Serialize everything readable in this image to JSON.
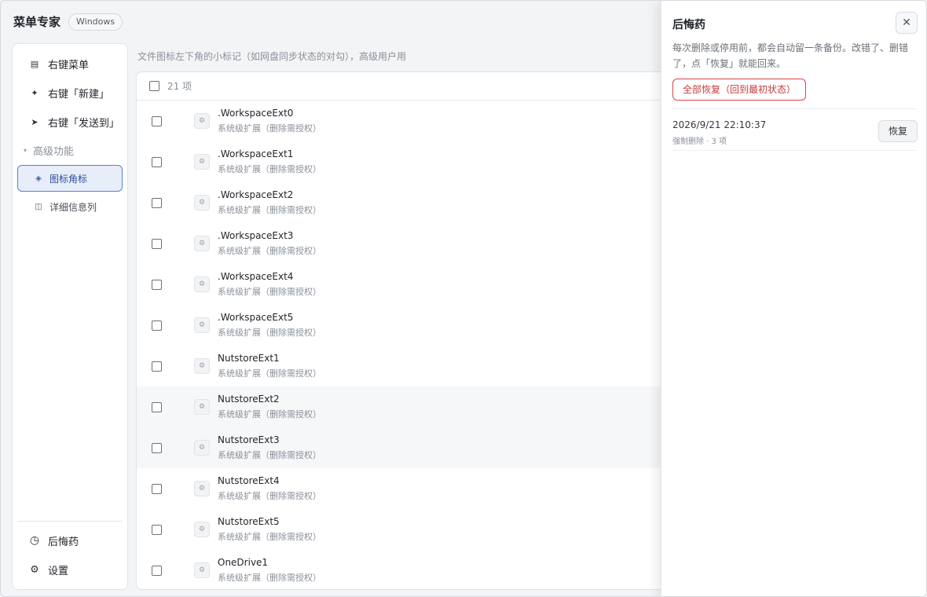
{
  "app": {
    "title": "菜单专家",
    "os_badge": "Windows"
  },
  "sidebar": {
    "items": [
      {
        "icon": "list-icon",
        "glyph": "▤",
        "label": "右键菜单"
      },
      {
        "icon": "sparkle-icon",
        "glyph": "✦",
        "label": "右键「新建」"
      },
      {
        "icon": "send-icon",
        "glyph": "➤",
        "label": "右键「发送到」"
      }
    ],
    "group": {
      "label": "高级功能",
      "glyph": "▾"
    },
    "sub_items": [
      {
        "icon": "badge-icon",
        "glyph": "◈",
        "label": "图标角标",
        "active": true
      },
      {
        "icon": "columns-icon",
        "glyph": "◫",
        "label": "详细信息列",
        "active": false
      }
    ],
    "bottom_items": [
      {
        "icon": "clock-icon",
        "glyph": "◷",
        "label": "后悔药"
      },
      {
        "icon": "gear-icon",
        "glyph": "⚙",
        "label": "设置"
      }
    ]
  },
  "main": {
    "hint": "文件图标左下角的小标记（如网盘同步状态的对勾），高级用户用",
    "count_label": "21 项",
    "rows": [
      {
        "name": ".WorkspaceExt0",
        "desc": "系统级扩展（删除需授权）"
      },
      {
        "name": ".WorkspaceExt1",
        "desc": "系统级扩展（删除需授权）"
      },
      {
        "name": ".WorkspaceExt2",
        "desc": "系统级扩展（删除需授权）"
      },
      {
        "name": ".WorkspaceExt3",
        "desc": "系统级扩展（删除需授权）"
      },
      {
        "name": ".WorkspaceExt4",
        "desc": "系统级扩展（删除需授权）"
      },
      {
        "name": ".WorkspaceExt5",
        "desc": "系统级扩展（删除需授权）"
      },
      {
        "name": "NutstoreExt1",
        "desc": "系统级扩展（删除需授权）"
      },
      {
        "name": "NutstoreExt2",
        "desc": "系统级扩展（删除需授权）"
      },
      {
        "name": "NutstoreExt3",
        "desc": "系统级扩展（删除需授权）"
      },
      {
        "name": "NutstoreExt4",
        "desc": "系统级扩展（删除需授权）"
      },
      {
        "name": "NutstoreExt5",
        "desc": "系统级扩展（删除需授权）"
      },
      {
        "name": "OneDrive1",
        "desc": "系统级扩展（删除需授权）"
      }
    ]
  },
  "drawer": {
    "title": "后悔药",
    "close_glyph": "✕",
    "description": "每次删除或停用前，都会自动留一条备份。改错了、删错了，点「恢复」就能回来。",
    "restore_all_label": "全部恢复（回到最初状态）",
    "backups": [
      {
        "time": "2026/9/21 22:10:37",
        "meta": "强制删除 · 3 项",
        "action_label": "恢复"
      }
    ]
  }
}
